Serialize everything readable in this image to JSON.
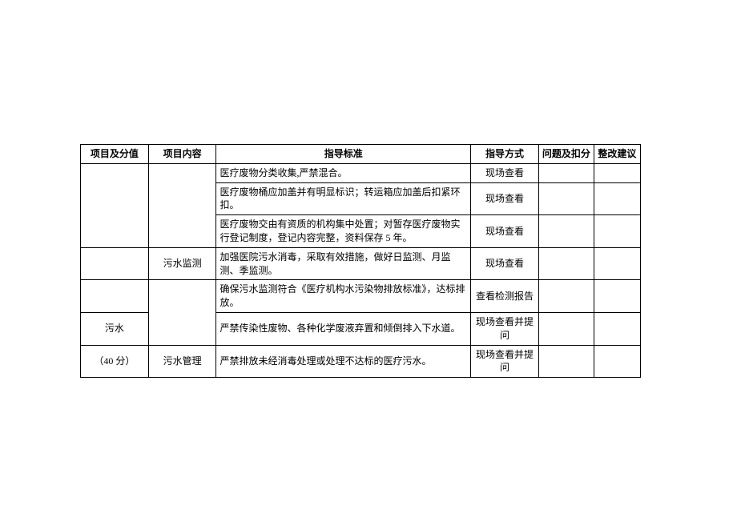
{
  "headers": {
    "category": "项目及分值",
    "content": "项目内容",
    "standard": "指导标准",
    "method": "指导方式",
    "issue": "问题及扣分",
    "advice": "整改建议"
  },
  "rows": [
    {
      "category": "",
      "content": "",
      "standard": "医疗废物分类收集,严禁混合。",
      "method": "现场查看"
    },
    {
      "category": "",
      "content": "",
      "standard": "医疗废物桶应加盖并有明显标识；转运箱应加盖后扣紧环扣。",
      "method": "现场查看"
    },
    {
      "category": "",
      "content": "",
      "standard": "医疗废物交由有资质的机构集中处置；对暂存医疗废物实行登记制度，登记内容完整，资料保存 5 年。",
      "method": "现场查看"
    },
    {
      "category": "",
      "content": "污水监测",
      "standard": "加强医院污水消毒，采取有效措施，做好日监测、月监测、季监测。",
      "method": "现场查看"
    },
    {
      "category": "",
      "content": "",
      "standard": "确保污水监测符合《医疗机构水污染物排放标准》，达标排放。",
      "method": "查看检测报告"
    },
    {
      "category": "污水",
      "content": "",
      "standard": "严禁传染性废物、各种化学废液弃置和倾倒排入下水道。",
      "method": "现场查看并提问"
    },
    {
      "category": "（40 分）",
      "content": "污水管理",
      "standard": "严禁排放未经消毒处理或处理不达标的医疗污水。",
      "method": "现场查看并提问"
    }
  ]
}
